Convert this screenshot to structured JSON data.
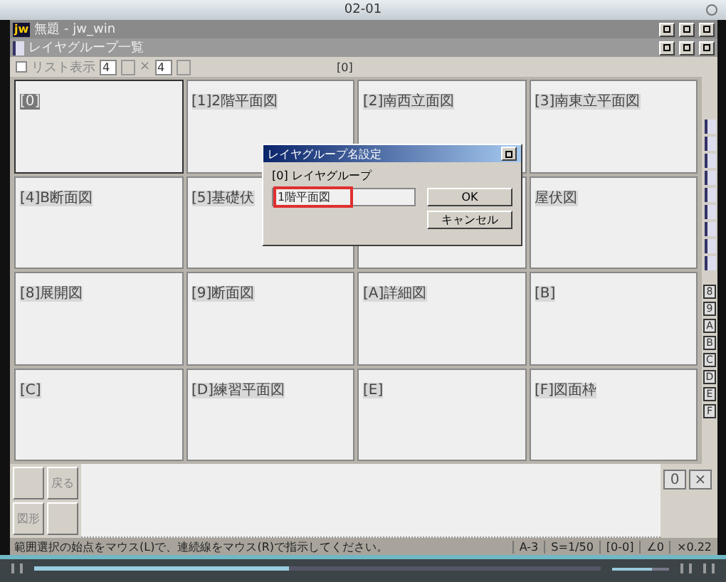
{
  "player": {
    "title": "02-01",
    "seek": {
      "level": 0.45
    },
    "volume": {
      "level": 0.7
    }
  },
  "window": {
    "title": "無題 - jw_win",
    "logo": "jw"
  },
  "child_window": {
    "title": "レイヤグループ一覧"
  },
  "toolbar": {
    "list_view": {
      "label": "リスト表示",
      "checked": false
    },
    "columns": "4",
    "times": "×",
    "rows": "4",
    "current": "[0]"
  },
  "cells": [
    {
      "label": "[0]",
      "selected": true
    },
    {
      "label": "[1]2階平面図",
      "selected": false
    },
    {
      "label": "[2]南西立面図",
      "selected": false
    },
    {
      "label": "[3]南東立平面図",
      "selected": false
    },
    {
      "label": "[4]B断面図",
      "selected": false
    },
    {
      "label": "[5]基礎伏",
      "selected": false
    },
    {
      "selected": false
    },
    {
      "label": "屋伏図",
      "selected": false
    },
    {
      "label": "[8]展開図",
      "selected": false
    },
    {
      "label": "[9]断面図",
      "selected": false
    },
    {
      "label": "[A]詳細図",
      "selected": false
    },
    {
      "label": "[B]",
      "selected": false
    },
    {
      "label": "[C]",
      "selected": false
    },
    {
      "label": "[D]練習平面図",
      "selected": false
    },
    {
      "label": "[E]",
      "selected": false
    },
    {
      "label": "[F]図面枠",
      "selected": false
    }
  ],
  "side_groups": [
    "8",
    "9",
    "A",
    "B",
    "C",
    "D",
    "E",
    "F"
  ],
  "bottom_left": [
    "戻る",
    "図形"
  ],
  "bottom_right": {
    "zero": "0",
    "close": "×"
  },
  "dialog": {
    "title": "レイヤグループ名設定",
    "label": "[0] レイヤグループ",
    "value": "1階平面図",
    "ok": "OK",
    "cancel": "キャンセル"
  },
  "status": {
    "message": "範囲選択の始点をマウス(L)で、連続線をマウス(R)で指示してください。",
    "fields": [
      "A-3",
      "S=1/50",
      "[0-0]",
      "∠0",
      "×0.22"
    ]
  }
}
